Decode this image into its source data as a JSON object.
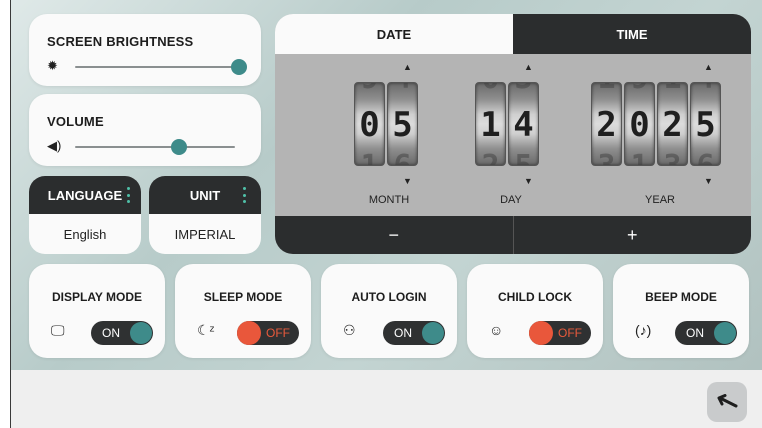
{
  "brightness": {
    "title": "SCREEN BRIGHTNESS",
    "icon": "sun-icon",
    "value": 1.0
  },
  "volume": {
    "title": "VOLUME",
    "icon": "speaker-icon",
    "value": 0.65
  },
  "language": {
    "label": "LANGUAGE",
    "value": "English"
  },
  "unit": {
    "label": "UNIT",
    "value": "IMPERIAL"
  },
  "datetime": {
    "tabs": {
      "date": "DATE",
      "time": "TIME"
    },
    "month": {
      "digits": [
        "0",
        "5"
      ],
      "label": "MONTH"
    },
    "day": {
      "digits": [
        "1",
        "4"
      ],
      "label": "DAY"
    },
    "year": {
      "digits": [
        "2",
        "0",
        "2",
        "5"
      ],
      "label": "YEAR"
    },
    "minus": "−",
    "plus": "+"
  },
  "toggles": [
    {
      "title": "DISPLAY MODE",
      "icon": "display-icon",
      "state": "ON"
    },
    {
      "title": "SLEEP MODE",
      "icon": "moon-zz-icon",
      "state": "OFF"
    },
    {
      "title": "AUTO LOGIN",
      "icon": "user-icon",
      "state": "ON"
    },
    {
      "title": "CHILD LOCK",
      "icon": "child-icon",
      "state": "OFF"
    },
    {
      "title": "BEEP MODE",
      "icon": "beep-icon",
      "state": "ON"
    }
  ],
  "colors": {
    "accent": "#3e8b8a",
    "off": "#e9573b",
    "dark": "#2b2d2e"
  }
}
